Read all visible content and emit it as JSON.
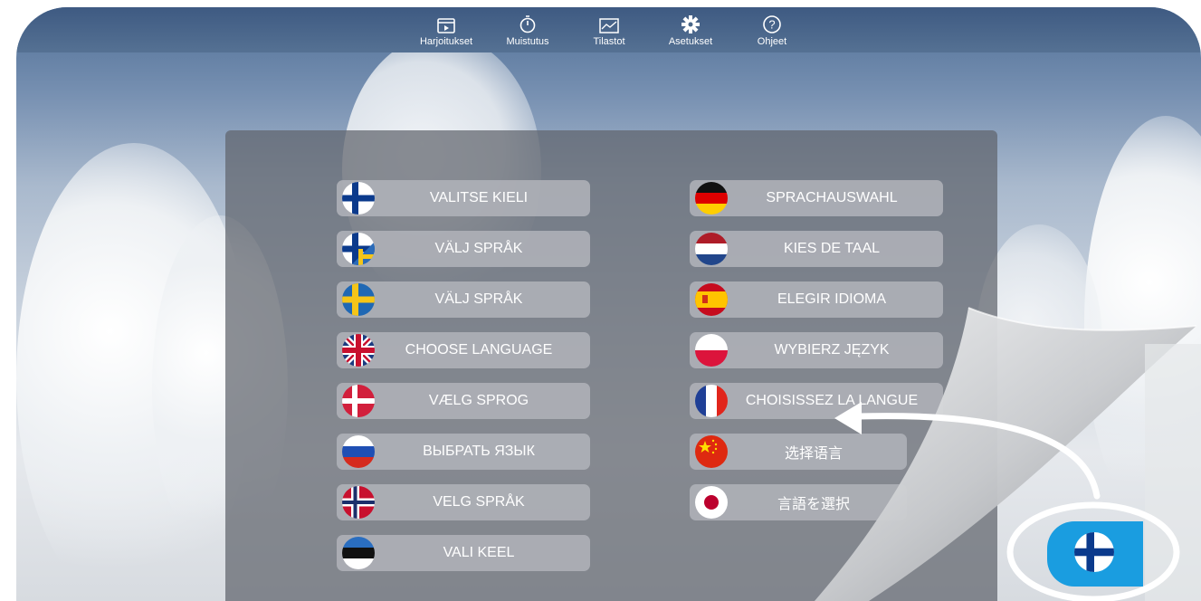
{
  "nav": [
    {
      "label": "Harjoitukset",
      "icon": "exercises-icon"
    },
    {
      "label": "Muistutus",
      "icon": "stopwatch-icon"
    },
    {
      "label": "Tilastot",
      "icon": "chart-icon"
    },
    {
      "label": "Asetukset",
      "icon": "gear-icon"
    },
    {
      "label": "Ohjeet",
      "icon": "help-icon"
    }
  ],
  "languages_left": [
    {
      "label": "VALITSE KIELI",
      "flag": "finland-flag-icon"
    },
    {
      "label": "VÄLJ SPRÅK",
      "flag": "finland-sweden-flag-icon"
    },
    {
      "label": "VÄLJ SPRÅK",
      "flag": "sweden-flag-icon"
    },
    {
      "label": "CHOOSE LANGUAGE",
      "flag": "uk-flag-icon"
    },
    {
      "label": "VÆLG SPROG",
      "flag": "denmark-flag-icon"
    },
    {
      "label": "ВЫБРАТЬ ЯЗЫК",
      "flag": "russia-flag-icon"
    },
    {
      "label": "VELG SPRÅK",
      "flag": "norway-flag-icon"
    },
    {
      "label": "VALI KEEL",
      "flag": "estonia-flag-icon"
    }
  ],
  "languages_right": [
    {
      "label": "SPRACHAUSWAHL",
      "flag": "germany-flag-icon"
    },
    {
      "label": "KIES DE TAAL",
      "flag": "netherlands-flag-icon"
    },
    {
      "label": "ELEGIR IDIOMA",
      "flag": "spain-flag-icon"
    },
    {
      "label": "WYBIERZ JĘZYK",
      "flag": "poland-flag-icon"
    },
    {
      "label": "CHOISISSEZ LA LANGUE",
      "flag": "france-flag-icon"
    },
    {
      "label": "选择语言",
      "flag": "china-flag-icon"
    },
    {
      "label": "言語を選択",
      "flag": "japan-flag-icon"
    }
  ],
  "fab": {
    "flag": "finland-flag-icon"
  }
}
